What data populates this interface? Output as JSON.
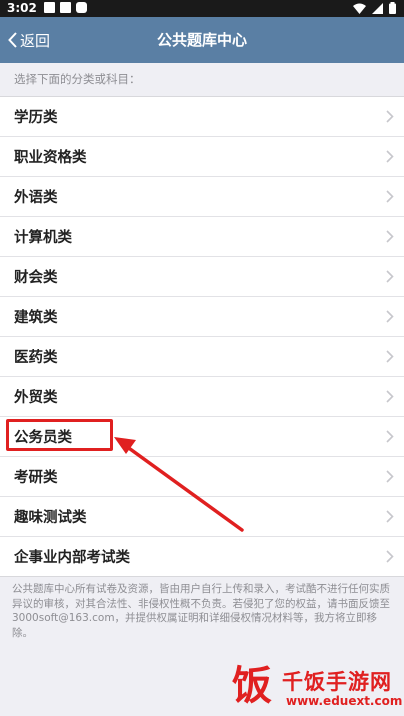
{
  "status_bar": {
    "time": "3:02"
  },
  "nav": {
    "back_label": "返回",
    "title": "公共题库中心"
  },
  "hint": "选择下面的分类或科目：",
  "categories": [
    {
      "label": "学历类"
    },
    {
      "label": "职业资格类"
    },
    {
      "label": "外语类"
    },
    {
      "label": "计算机类"
    },
    {
      "label": "财会类"
    },
    {
      "label": "建筑类"
    },
    {
      "label": "医药类"
    },
    {
      "label": "外贸类"
    },
    {
      "label": "公务员类"
    },
    {
      "label": "考研类"
    },
    {
      "label": "趣味测试类"
    },
    {
      "label": "企事业内部考试类"
    }
  ],
  "footer_note": "公共题库中心所有试卷及资源，皆由用户自行上传和录入，考试酷不进行任何实质异议的审核，对其合法性、非侵权性概不负责。若侵犯了您的权益，请书面反馈至3000soft@163.com，并提供权属证明和详细侵权情况材料等，我方将立即移除。",
  "watermark": {
    "logo_char": "饭",
    "title": "千饭手游网",
    "url": "www.eduext.com"
  },
  "colors": {
    "nav_bg": "#5a7fa4",
    "page_bg": "#efeff4",
    "annotation_red": "#e02020"
  }
}
